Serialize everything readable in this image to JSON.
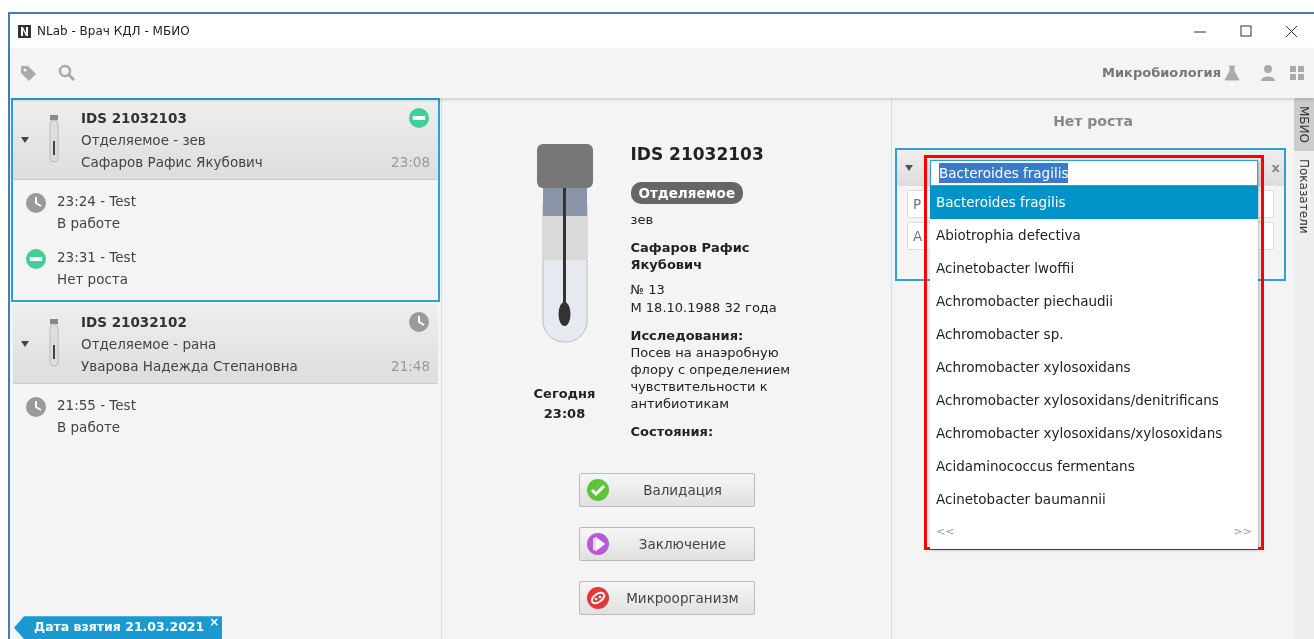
{
  "window": {
    "title": "NLab - Врач КДЛ - МБИО"
  },
  "toolbar": {
    "department": "Микробиология"
  },
  "samples": [
    {
      "id": "IDS 21032103",
      "material_line": "Отделяемое  -  зев",
      "patient": "Сафаров Рафис Якубович",
      "time": "23:08",
      "kind": "no-growth",
      "expanded": true,
      "selected": true,
      "events": [
        {
          "line": "23:24  - Test",
          "label": "В работе",
          "kind": "in-progress"
        },
        {
          "line": "23:31  - Test",
          "label": "Нет роста",
          "kind": "no-growth"
        }
      ]
    },
    {
      "id": "IDS 21032102",
      "material_line": "Отделяемое  -  рана",
      "patient": "Уварова Надежда Степановна",
      "time": "21:48",
      "kind": "in-progress",
      "expanded": true,
      "selected": false,
      "events": [
        {
          "line": "21:55  - Test",
          "label": "В работе",
          "kind": "in-progress"
        }
      ]
    }
  ],
  "filter_chip": {
    "label": "Дата взятия 21.03.2021",
    "close": "×"
  },
  "detail": {
    "id": "IDS 21032103",
    "material": "Отделяемое",
    "site": "зев",
    "patient": "Сафаров Рафис Якубович",
    "number": "№ 13",
    "demographics": "М  18.10.1988  32 года",
    "studies_label": "Исследования:",
    "studies": "Посев на анаэробную флору с определением чувствительности к антибиотикам",
    "states_label": "Состояния:",
    "date": "Сегодня",
    "time": "23:08",
    "actions": [
      {
        "label": "Валидация",
        "kind": "validate"
      },
      {
        "label": "Заключение",
        "kind": "conclusion"
      },
      {
        "label": "Микроорганизм",
        "kind": "organism"
      }
    ]
  },
  "result": {
    "title": "Нет роста",
    "close": "x",
    "organism_input": {
      "value": "Bacteroides fragilis"
    },
    "fields": [
      {
        "placeholder": "Р"
      },
      {
        "placeholder": "А"
      }
    ],
    "dropdown": {
      "items": [
        {
          "label": "Bacteroides fragilis",
          "selected": true
        },
        {
          "label": "Abiotrophia defectiva",
          "selected": false
        },
        {
          "label": "Acinetobacter lwoffii",
          "selected": false
        },
        {
          "label": "Achromobacter piechaudii",
          "selected": false
        },
        {
          "label": "Achromobacter sp.",
          "selected": false
        },
        {
          "label": "Achromobacter xylosoxidans",
          "selected": false
        },
        {
          "label": "Achromobacter xylosoxidans/denitrificans",
          "selected": false
        },
        {
          "label": "Achromobacter xylosoxidans/xylosoxidans",
          "selected": false
        },
        {
          "label": "Acidaminococcus fermentans",
          "selected": false
        },
        {
          "label": "Acinetobacter baumannii",
          "selected": false
        }
      ],
      "prev": "<<",
      "next": ">>"
    }
  },
  "side_tabs": [
    {
      "label": "МБИО",
      "selected": true
    },
    {
      "label": "Показатели",
      "selected": false
    }
  ]
}
